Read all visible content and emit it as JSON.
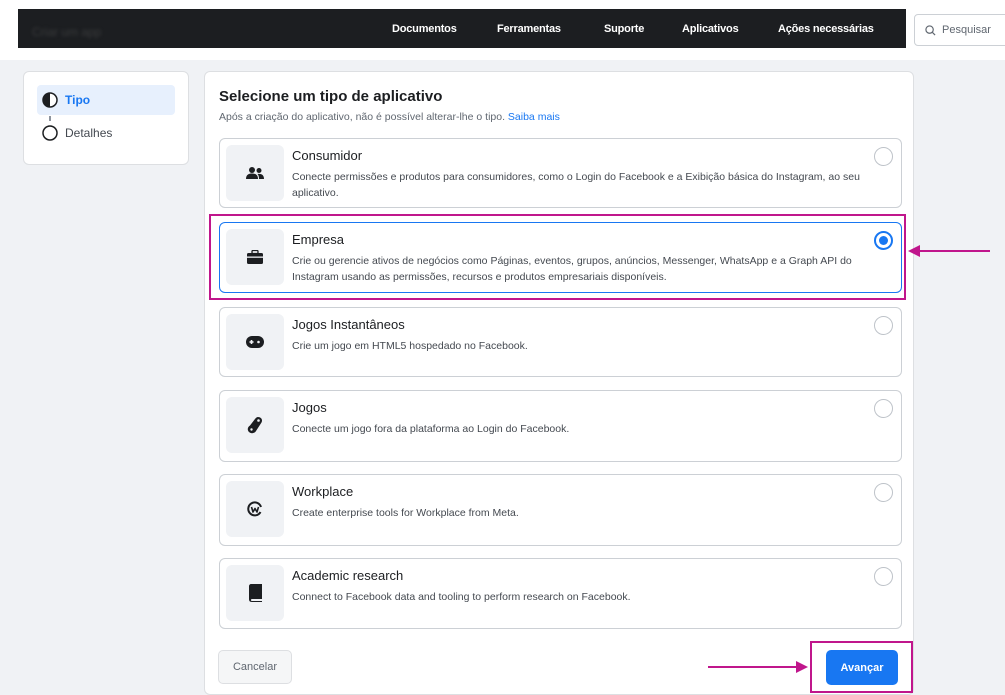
{
  "topbar": {
    "app_name": "Criar um app",
    "nav": [
      "Documentos",
      "Ferramentas",
      "Suporte",
      "Aplicativos",
      "Ações necessárias"
    ],
    "search_placeholder": "Pesquisar"
  },
  "stepper": {
    "steps": [
      {
        "label": "Tipo",
        "active": true
      },
      {
        "label": "Detalhes",
        "active": false
      }
    ]
  },
  "main": {
    "title": "Selecione um tipo de aplicativo",
    "subtitle": "Após a criação do aplicativo, não é possível alterar-lhe o tipo.",
    "learn_more": "Saiba mais",
    "options": [
      {
        "title": "Consumidor",
        "description": "Conecte permissões e produtos para consumidores, como o Login do Facebook e a Exibição básica do Instagram, ao seu aplicativo.",
        "icon": "people-icon",
        "selected": false
      },
      {
        "title": "Empresa",
        "description": "Crie ou gerencie ativos de negócios como Páginas, eventos, grupos, anúncios, Messenger, WhatsApp e a Graph API do Instagram usando as permissões, recursos e produtos empresariais disponíveis.",
        "icon": "briefcase-icon",
        "selected": true
      },
      {
        "title": "Jogos Instantâneos",
        "description": "Crie um jogo em HTML5 hospedado no Facebook.",
        "icon": "gamepad-icon",
        "selected": false
      },
      {
        "title": "Jogos",
        "description": "Conecte um jogo fora da plataforma ao Login do Facebook.",
        "icon": "joystick-icon",
        "selected": false
      },
      {
        "title": "Workplace",
        "description": "Create enterprise tools for Workplace from Meta.",
        "icon": "workplace-icon",
        "selected": false
      },
      {
        "title": "Academic research",
        "description": "Connect to Facebook data and tooling to perform research on Facebook.",
        "icon": "book-icon",
        "selected": false
      }
    ],
    "cancel_label": "Cancelar",
    "next_label": "Avançar"
  },
  "colors": {
    "accent": "#1877f2",
    "highlight": "#c0168c",
    "topbar": "#1c1e21"
  }
}
